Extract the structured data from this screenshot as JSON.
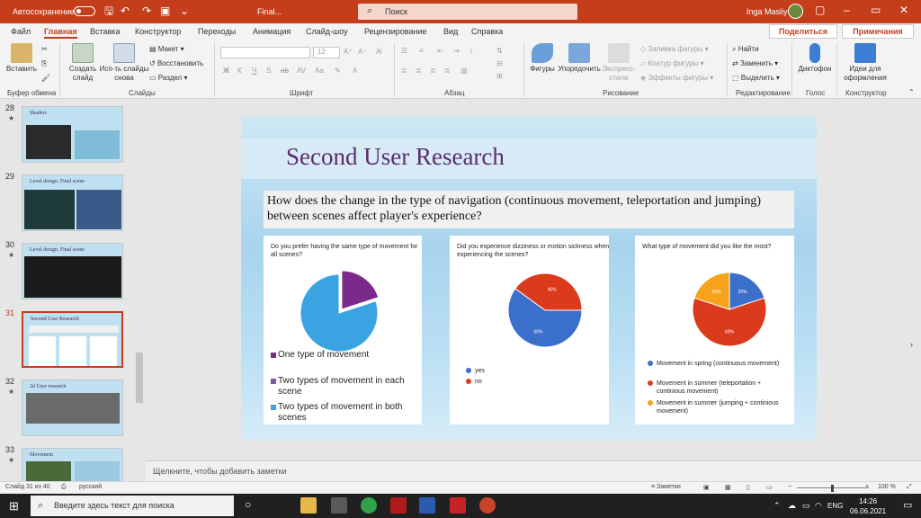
{
  "titlebar": {
    "autosave_label": "Автосохранение",
    "autosave_state": "off",
    "filename": "Final...",
    "search_placeholder": "Поиск",
    "user": "Inga Masliy"
  },
  "tabs": [
    "Файл",
    "Главная",
    "Вставка",
    "Конструктор",
    "Переходы",
    "Анимация",
    "Слайд-шоу",
    "Рецензирование",
    "Вид",
    "Справка"
  ],
  "active_tab": "Главная",
  "share_label": "Поделиться",
  "comments_label": "Примечания",
  "ribbon": {
    "paste": "Вставить",
    "clipboard_group": "Буфер обмена",
    "new_slide": "Создать слайд",
    "reuse_slides": "Исп-ть слайды снова",
    "layout": "Макет",
    "reset": "Восстановить",
    "section": "Раздел",
    "slides_group": "Слайды",
    "font_size": "12",
    "font_group": "Шрифт",
    "paragraph_group": "Абзац",
    "shapes": "Фигуры",
    "arrange": "Упорядочить",
    "quick_styles": "Экспресс-стили",
    "shape_fill": "Заливка фигуры",
    "shape_outline": "Контур фигуры",
    "shape_effects": "Эффекты фигуры",
    "drawing_group": "Рисование",
    "find": "Найти",
    "replace": "Заменить",
    "select": "Выделить",
    "editing_group": "Редактирование",
    "dictate": "Диктофон",
    "voice_group": "Голос",
    "design_ideas": "Идеи для оформления",
    "designer_group": "Конструктор"
  },
  "thumbnails": [
    {
      "num": "28",
      "star": "★",
      "title": "Shaders"
    },
    {
      "num": "29",
      "star": "",
      "title": "Level design. Final scene"
    },
    {
      "num": "30",
      "star": "★",
      "title": "Level design. Final scene"
    },
    {
      "num": "31",
      "star": "",
      "title": "Second User Research"
    },
    {
      "num": "32",
      "star": "★",
      "title": "2d User research"
    },
    {
      "num": "33",
      "star": "★",
      "title": "Movement"
    }
  ],
  "slide": {
    "title": "Second User Research",
    "question": "How does the change in the type of navigation (continuous movement, teleportation and jumping) between scenes affect player's experience?",
    "panel1": {
      "question": "Do you prefer having the same type of movement for all scenes?",
      "legend": [
        "One type of movement",
        "Two types of movement in each scene",
        "Two types of movement in both scenes"
      ]
    },
    "panel2": {
      "question": "Did you experience dizziness or motion sickness when experiencing the scenes?",
      "legend": [
        "yes",
        "no"
      ]
    },
    "panel3": {
      "question": "What type of movement did you like the most?",
      "legend": [
        "Movement in spring (continuous movement)",
        "Movement in summer (teleportation + continious movement)",
        "Movement in summer (jumping + continious movement)"
      ]
    }
  },
  "chart_data": [
    {
      "type": "pie",
      "categories": [
        "One type of movement",
        "Two types of movement in each scene",
        "Two types of movement in both scenes"
      ],
      "values": [
        20,
        0,
        80
      ],
      "colors": [
        "#7b2a8c",
        "#7b5ea7",
        "#3aa4e3"
      ]
    },
    {
      "type": "pie",
      "categories": [
        "yes",
        "no"
      ],
      "values": [
        60,
        40
      ],
      "labels": [
        "60%",
        "40%"
      ],
      "colors": [
        "#3b6fcc",
        "#dc3a1c"
      ]
    },
    {
      "type": "pie",
      "categories": [
        "Movement in spring (continuous movement)",
        "Movement in summer (teleportation + continious movement)",
        "Movement in summer (jumping + continious movement)"
      ],
      "values": [
        20,
        60,
        20
      ],
      "labels": [
        "20%",
        "60%",
        "20%"
      ],
      "colors": [
        "#3b6fcc",
        "#dc3a1c",
        "#f6a31b"
      ]
    }
  ],
  "notes_placeholder": "Щелкните, чтобы добавить заметки",
  "status": {
    "slide_counter": "Слайд 31 из 40",
    "language": "русский",
    "notes": "Заметки",
    "zoom": "100 %"
  },
  "taskbar": {
    "search_placeholder": "Введите здесь текст для поиска",
    "lang": "ENG",
    "time": "14:26",
    "date": "06.06.2021"
  }
}
